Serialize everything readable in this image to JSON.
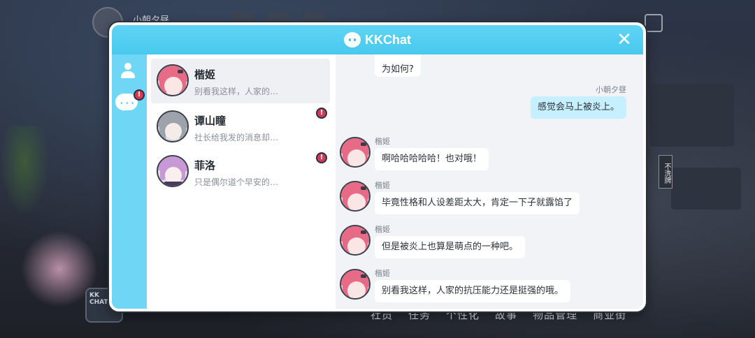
{
  "background": {
    "player_name": "小朝夕昼",
    "side_tag": "不洗牌",
    "kk_tile": "KK CHAT",
    "bottom_nav": [
      "社员",
      "任务",
      "个性化",
      "故事",
      "物品管理",
      "商业街"
    ]
  },
  "window": {
    "title": "KKChat",
    "close_symbol": "✕"
  },
  "sidebar": {
    "contacts_icon": "contacts-icon",
    "chat_icon": "chat-bubble-icon",
    "alert_symbol": "!"
  },
  "conversations": [
    {
      "name": "楷姬",
      "preview": "别看我这样，人家的…",
      "active": true,
      "unread": false,
      "avatar": "pink"
    },
    {
      "name": "谭山瞳",
      "preview": "社长给我发的消息却…",
      "active": false,
      "unread": true,
      "avatar": "grey"
    },
    {
      "name": "菲洛",
      "preview": "只是偶尔道个早安的…",
      "active": false,
      "unread": true,
      "avatar": "purple"
    }
  ],
  "messages": {
    "partial_top": "为如何?",
    "items": [
      {
        "sender": "小朝夕昼",
        "text": "感觉会马上被炎上。",
        "outgoing": true
      },
      {
        "sender": "楷姬",
        "text": "啊哈哈哈哈哈！也对哦！",
        "outgoing": false
      },
      {
        "sender": "楷姬",
        "text": "毕竟性格和人设差距太大，肯定一下子就露馅了",
        "outgoing": false
      },
      {
        "sender": "楷姬",
        "text": "但是被炎上也算是萌点的一种吧。",
        "outgoing": false
      },
      {
        "sender": "楷姬",
        "text": "别看我这样，人家的抗压能力还是挺强的哦。",
        "outgoing": false
      }
    ]
  },
  "colors": {
    "accent": "#49c8ee",
    "outgoing_bubble": "#c6efff",
    "alert": "#d33a58"
  }
}
